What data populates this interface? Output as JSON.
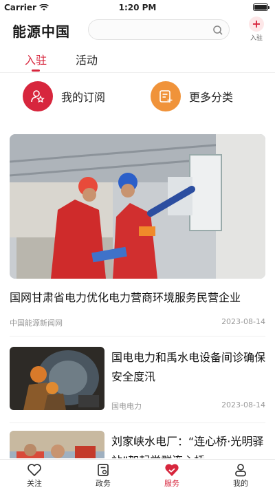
{
  "status": {
    "carrier": "Carrier",
    "time": "1:20 PM"
  },
  "header": {
    "logo": "能源中国",
    "search_placeholder": "",
    "join_label": "入驻"
  },
  "tabs": [
    {
      "label": "入驻",
      "active": true
    },
    {
      "label": "活动",
      "active": false
    }
  ],
  "quick_actions": [
    {
      "label": "我的订阅",
      "icon": "subscription-icon",
      "color": "#d7263d"
    },
    {
      "label": "更多分类",
      "icon": "category-icon",
      "color": "#f0933a"
    }
  ],
  "feature": {
    "title": "国网甘肃省电力优化电力营商环境服务民营企业",
    "source": "中国能源新闻网",
    "date": "2023-08-14"
  },
  "articles": [
    {
      "title": "国电电力和禹水电设备间诊确保安全度汛",
      "source": "国电电力",
      "date": "2023-08-14"
    },
    {
      "title": "刘家峡水电厂：“连心桥·光明驿站”架起党群连心桥",
      "source": "",
      "date": ""
    }
  ],
  "tabbar": [
    {
      "label": "关注",
      "icon": "heart-icon",
      "active": false
    },
    {
      "label": "政务",
      "icon": "document-icon",
      "active": false
    },
    {
      "label": "服务",
      "icon": "service-icon",
      "active": true
    },
    {
      "label": "我的",
      "icon": "user-icon",
      "active": false
    }
  ],
  "colors": {
    "accent": "#d7263d",
    "orange": "#f0933a"
  }
}
